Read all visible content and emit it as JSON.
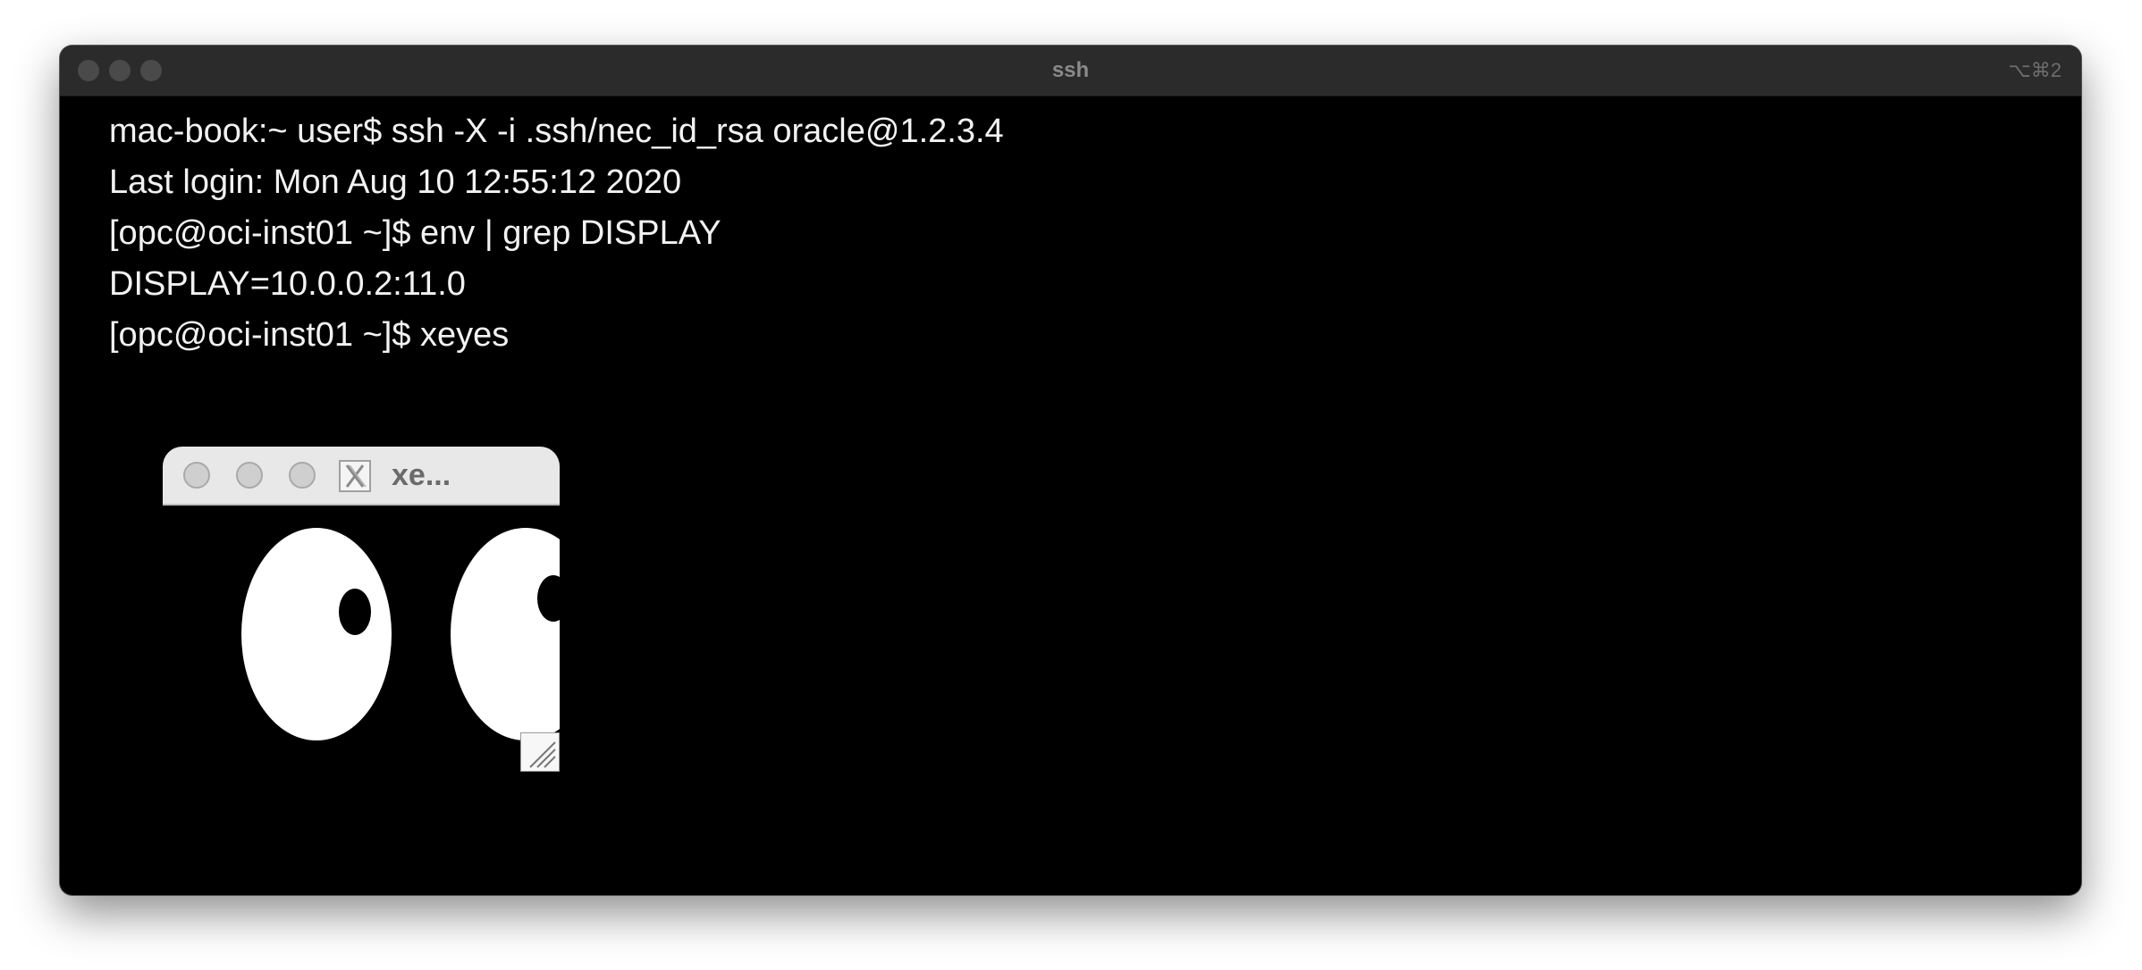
{
  "window": {
    "title": "ssh",
    "shortcut": "⌥⌘2"
  },
  "terminal": {
    "lines": [
      "mac-book:~ user$ ssh -X -i .ssh/nec_id_rsa oracle@1.2.3.4",
      "Last login: Mon Aug 10 12:55:12 2020",
      "[opc@oci-inst01 ~]$ env | grep DISPLAY",
      "DISPLAY=10.0.0.2:11.0",
      "[opc@oci-inst01 ~]$ xeyes"
    ]
  },
  "xeyes": {
    "title": "xe...",
    "icons": {
      "logo": "x-window-logo-icon",
      "grip": "resize-grip-icon"
    }
  },
  "colors": {
    "terminal_bg": "#000000",
    "terminal_text": "#f2f2f2",
    "titlebar_bg": "#2b2b2b",
    "xeyes_titlebar": "#e8e8e8"
  }
}
